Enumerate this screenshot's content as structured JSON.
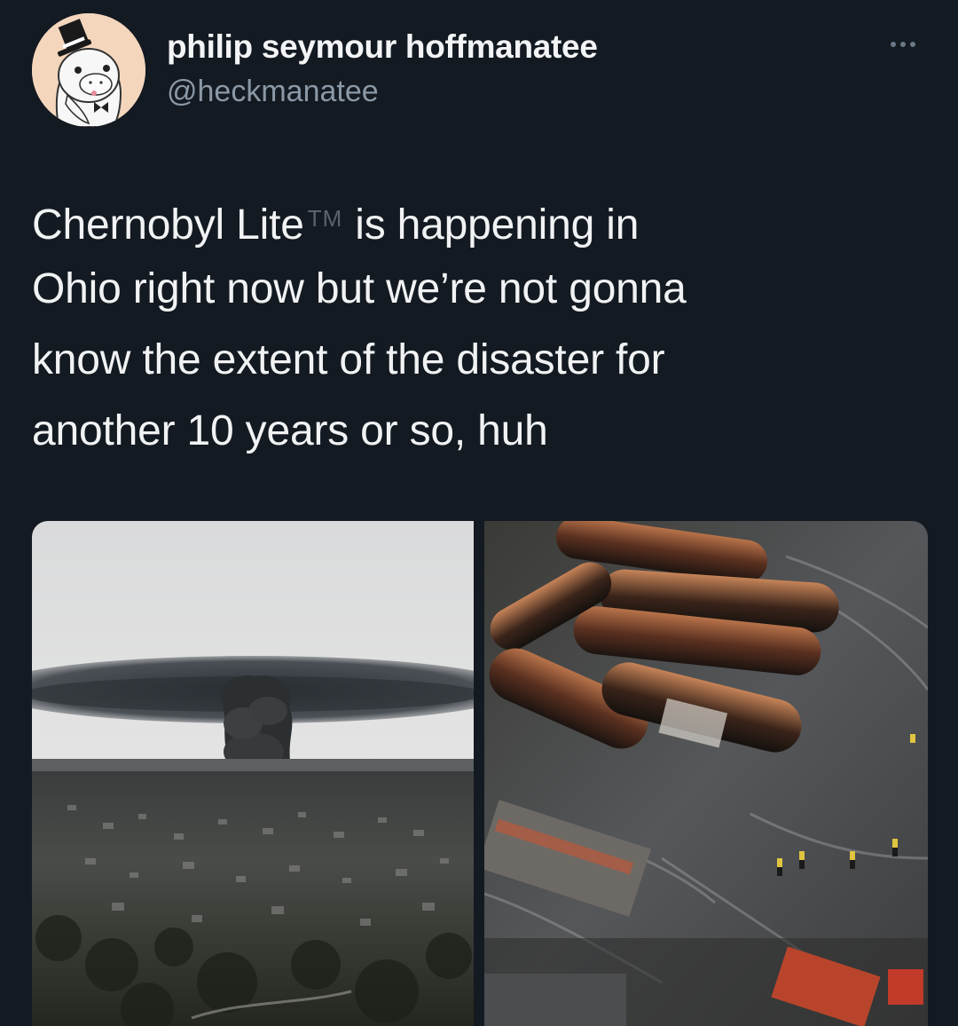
{
  "author": {
    "display_name": "philip seymour hoffmanatee",
    "handle": "@heckmanatee",
    "avatar_icon": "manatee-with-top-hat-avatar"
  },
  "tweet": {
    "lines": [
      {
        "before_tm": "Chernobyl Lite",
        "tm": "TM",
        "after_tm": "is happening in"
      },
      {
        "text": "Ohio right now but we’re not gonna"
      },
      {
        "text": "know the extent of the disaster for"
      },
      {
        "text": "another 10 years or so, huh"
      }
    ]
  },
  "media": [
    {
      "icon": "town-smoke-cloud-photo"
    },
    {
      "icon": "derailed-tank-cars-photo"
    }
  ],
  "colors": {
    "background": "#141a22",
    "text": "#f1f2f3",
    "secondary_text": "#8b98a5"
  }
}
